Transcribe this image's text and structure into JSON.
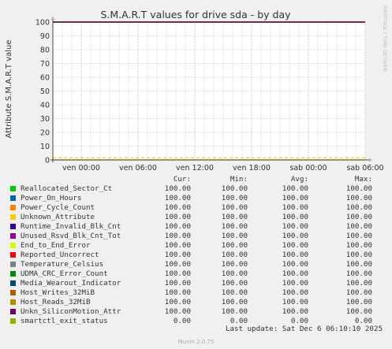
{
  "chart_data": {
    "type": "line",
    "title": "S.M.A.R.T values for drive sda - by day",
    "ylabel": "Attribute S.M.A.R.T value",
    "xlabel": "",
    "ylim": [
      0,
      100
    ],
    "yticks": [
      "0",
      "10",
      "20",
      "30",
      "40",
      "50",
      "60",
      "70",
      "80",
      "90",
      "100"
    ],
    "xticks": [
      "ven 00:00",
      "ven 06:00",
      "ven 12:00",
      "ven 18:00",
      "sab 00:00",
      "sab 06:00"
    ],
    "grid": true,
    "series": [
      {
        "name": "Reallocated_Sector_Ct",
        "color": "#00cc00",
        "cur": "100.00",
        "min": "100.00",
        "avg": "100.00",
        "max": "100.00",
        "level": 100
      },
      {
        "name": "Power_On_Hours",
        "color": "#0066b3",
        "cur": "100.00",
        "min": "100.00",
        "avg": "100.00",
        "max": "100.00",
        "level": 100
      },
      {
        "name": "Power_Cycle_Count",
        "color": "#ff8000",
        "cur": "100.00",
        "min": "100.00",
        "avg": "100.00",
        "max": "100.00",
        "level": 100
      },
      {
        "name": "Unknown_Attribute",
        "color": "#ffcc00",
        "cur": "100.00",
        "min": "100.00",
        "avg": "100.00",
        "max": "100.00",
        "level": 100
      },
      {
        "name": "Runtime_Invalid_Blk_Cnt",
        "color": "#330099",
        "cur": "100.00",
        "min": "100.00",
        "avg": "100.00",
        "max": "100.00",
        "level": 100
      },
      {
        "name": "Unused_Rsvd_Blk_Cnt_Tot",
        "color": "#990099",
        "cur": "100.00",
        "min": "100.00",
        "avg": "100.00",
        "max": "100.00",
        "level": 100
      },
      {
        "name": "End_to_End_Error",
        "color": "#ccff00",
        "cur": "100.00",
        "min": "100.00",
        "avg": "100.00",
        "max": "100.00",
        "level": 100
      },
      {
        "name": "Reported_Uncorrect",
        "color": "#ff0000",
        "cur": "100.00",
        "min": "100.00",
        "avg": "100.00",
        "max": "100.00",
        "level": 100
      },
      {
        "name": "Temperature_Celsius",
        "color": "#808080",
        "cur": "100.00",
        "min": "100.00",
        "avg": "100.00",
        "max": "100.00",
        "level": 100
      },
      {
        "name": "UDMA_CRC_Error_Count",
        "color": "#008f00",
        "cur": "100.00",
        "min": "100.00",
        "avg": "100.00",
        "max": "100.00",
        "level": 100
      },
      {
        "name": "Media_Wearout_Indicator",
        "color": "#00487d",
        "cur": "100.00",
        "min": "100.00",
        "avg": "100.00",
        "max": "100.00",
        "level": 100
      },
      {
        "name": "Host_Writes_32MiB",
        "color": "#b35a00",
        "cur": "100.00",
        "min": "100.00",
        "avg": "100.00",
        "max": "100.00",
        "level": 100
      },
      {
        "name": "Host_Reads_32MiB",
        "color": "#b38f00",
        "cur": "100.00",
        "min": "100.00",
        "avg": "100.00",
        "max": "100.00",
        "level": 100
      },
      {
        "name": "Unkn_SiliconMotion_Attr",
        "color": "#6b006b",
        "cur": "100.00",
        "min": "100.00",
        "avg": "100.00",
        "max": "100.00",
        "level": 100
      },
      {
        "name": "smartctl_exit_status",
        "color": "#8fb300",
        "cur": "0.00",
        "min": "0.00",
        "avg": "0.00",
        "max": "0.00",
        "level": 0
      }
    ],
    "threshold": {
      "color": "#ffcc00",
      "level": 1
    }
  },
  "legend_headers": {
    "cur": "Cur:",
    "min": "Min:",
    "avg": "Avg:",
    "max": "Max:"
  },
  "last_update": "Last update: Sat Dec  6 06:10:10 2025",
  "side_text": "RRDTOOL / TOBI OETIKER",
  "footer": "Munin 2.0.75",
  "colors": {
    "background": "#f0f0f0",
    "plot_background": "#ffffff",
    "grid": "#e8b8b8",
    "axis": "#444444"
  }
}
